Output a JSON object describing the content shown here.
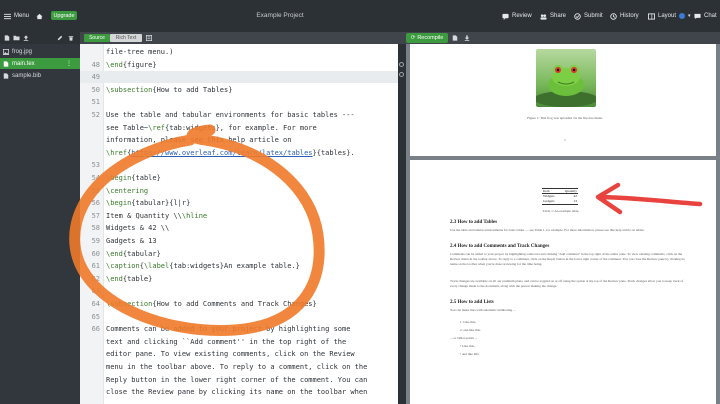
{
  "toolbar": {
    "menu_label": "Menu",
    "upgrade_label": "Upgrade",
    "project_title": "Example Project",
    "review_label": "Review",
    "share_label": "Share",
    "submit_label": "Submit",
    "history_label": "History",
    "layout_label": "Layout",
    "chat_label": "Chat"
  },
  "editor_tabs": {
    "source_label": "Source",
    "rich_text_label": "Rich Text"
  },
  "pdf_toolbar": {
    "recompile_label": "Recompile"
  },
  "file_tree": {
    "files": [
      {
        "name": "frog.jpg",
        "icon": "image-icon"
      },
      {
        "name": "main.tex",
        "icon": "file-text-icon",
        "active": true
      },
      {
        "name": "sample.bib",
        "icon": "file-icon"
      }
    ]
  },
  "editor": {
    "lines": [
      {
        "n": "",
        "text": "file-tree menu.)"
      },
      {
        "n": "48",
        "text": "\\end{figure}"
      },
      {
        "n": "49",
        "text": "",
        "highlight": true
      },
      {
        "n": "50",
        "text": "\\subsection{How to add Tables}"
      },
      {
        "n": "51",
        "text": ""
      },
      {
        "n": "52",
        "text": "Use the table and tabular environments for basic tables ---"
      },
      {
        "n": "",
        "text": "see Table~\\ref{tab:widgets}, for example. For more"
      },
      {
        "n": "",
        "text": "information, please see this help article on"
      },
      {
        "n": "",
        "text": "\\href{https://www.overleaf.com/learn/latex/tables}{tables}."
      },
      {
        "n": "53",
        "text": ""
      },
      {
        "n": "54",
        "text": "\\begin{table}"
      },
      {
        "n": "55",
        "text": "\\centering"
      },
      {
        "n": "56",
        "text": "\\begin{tabular}{l|r}"
      },
      {
        "n": "57",
        "text": "Item & Quantity \\\\\\hline"
      },
      {
        "n": "58",
        "text": "Widgets & 42 \\\\"
      },
      {
        "n": "59",
        "text": "Gadgets & 13"
      },
      {
        "n": "60",
        "text": "\\end{tabular}"
      },
      {
        "n": "61",
        "text": "\\caption{\\label{tab:widgets}An example table.}"
      },
      {
        "n": "62",
        "text": "\\end{table}"
      },
      {
        "n": "63",
        "text": ""
      },
      {
        "n": "64",
        "text": "\\subsection{How to add Comments and Track Changes}"
      },
      {
        "n": "65",
        "text": ""
      },
      {
        "n": "66",
        "text": "Comments can be added to your project by highlighting some"
      },
      {
        "n": "",
        "text": "text and clicking ``Add comment'' in the top right of the"
      },
      {
        "n": "",
        "text": "editor pane. To view existing comments, click on the Review"
      },
      {
        "n": "",
        "text": "menu in the toolbar above. To reply to a comment, click on the"
      },
      {
        "n": "",
        "text": "Reply button in the lower right corner of the comment. You can"
      },
      {
        "n": "",
        "text": "close the Review pane by clicking its name on the toolbar when"
      }
    ]
  },
  "pdf": {
    "figure_caption": "Figure 1: This frog was uploaded via the file-tree menu.",
    "page_number": "1",
    "table": {
      "headers": [
        "Item",
        "Quantity"
      ],
      "rows": [
        [
          "Widgets",
          "42"
        ],
        [
          "Gadgets",
          "13"
        ]
      ],
      "caption": "Table 1: An example table."
    },
    "sections": [
      {
        "heading": "2.3   How to add Tables",
        "body": "Use the table and tabular environments for basic tables — see Table 1, for example. For more information, please see this help article on tables."
      },
      {
        "heading": "2.4   How to add Comments and Track Changes",
        "body": "Comments can be added to your project by highlighting some text and clicking \"Add comment\" in the top right of the editor pane. To view existing comments, click on the Review menu in the toolbar above. To reply to a comment, click on the Reply button in the lower right corner of the comment. You can close the Review pane by clicking its name on the toolbar when you're done reviewing for the time being.",
        "body2": "Track changes are available on all our premium plans, and can be toggled on or off using the option at the top of the Review pane. Track changes allow you to keep track of every change made to the document, along with the person making the change."
      },
      {
        "heading": "2.5   How to add Lists",
        "body": "You can make lists with automatic numbering ..."
      }
    ],
    "list_items": [
      "1. Like this,",
      "2. and like this.",
      "... or bullet points ...",
      "• Like this,",
      "• and like this."
    ]
  },
  "annotation_colors": {
    "circle": "#f07a2a",
    "arrow": "#e8433f"
  }
}
